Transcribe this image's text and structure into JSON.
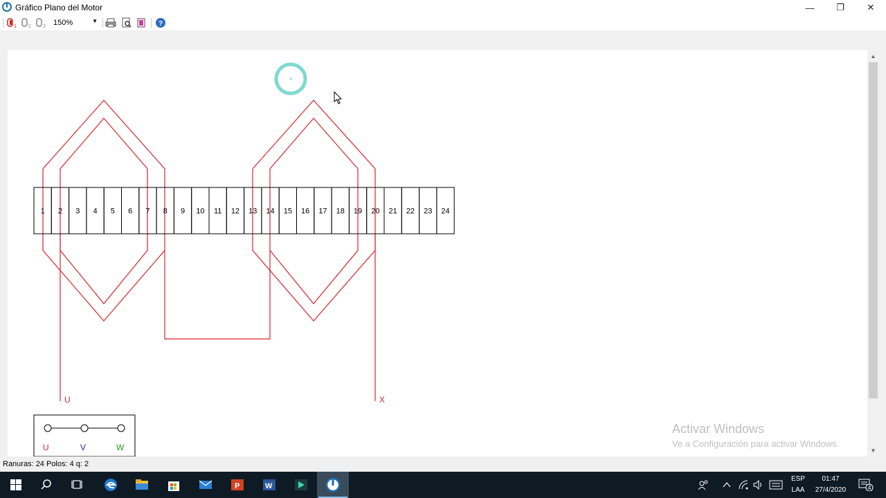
{
  "window": {
    "title": "Gráfico Plano del Motor",
    "controls": {
      "minimize": "—",
      "restore": "❐",
      "close": "✕"
    }
  },
  "toolbar": {
    "zoom": "150%",
    "icons": [
      "phase-1-icon",
      "phase-2-icon",
      "phase-3-icon",
      "print-icon",
      "print-preview-icon",
      "export-icon",
      "help-icon"
    ]
  },
  "diagram": {
    "slot_count": 24,
    "slots": [
      "1",
      "2",
      "3",
      "4",
      "5",
      "6",
      "7",
      "8",
      "9",
      "10",
      "11",
      "12",
      "13",
      "14",
      "15",
      "16",
      "17",
      "18",
      "19",
      "20",
      "21",
      "22",
      "23",
      "24"
    ],
    "coil_color": "#d9232e",
    "terminals": {
      "start": "U",
      "end": "X"
    }
  },
  "legend": {
    "phases": [
      {
        "label": "U",
        "color": "#d9232e"
      },
      {
        "label": "V",
        "color": "#1a1ab0"
      },
      {
        "label": "W",
        "color": "#1f9a1f"
      }
    ]
  },
  "watermark": {
    "title": "Activar Windows",
    "subtitle": "Ve a Configuración para activar Windows."
  },
  "status": {
    "text": "Ranuras: 24  Polos: 4  q: 2"
  },
  "taskbar": {
    "apps": [
      "start",
      "search",
      "task-view",
      "edge",
      "file-explorer",
      "store",
      "mail",
      "powerpoint",
      "word",
      "filmora",
      "motor-app"
    ],
    "tray": {
      "language_top": "ESP",
      "language_bottom": "LAA",
      "time": "01:47",
      "date": "27/4/2020",
      "notification_count": "4"
    }
  }
}
